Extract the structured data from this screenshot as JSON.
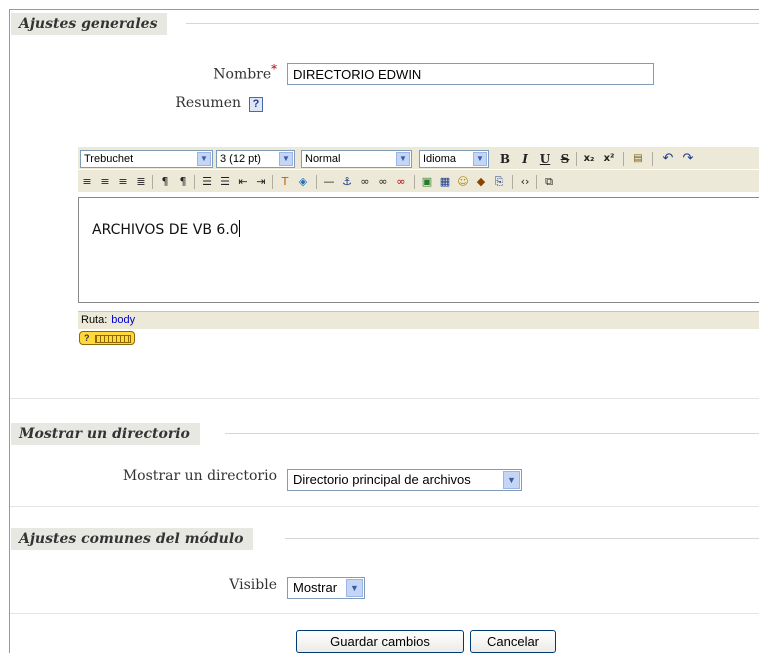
{
  "general": {
    "legend": "Ajustes generales",
    "name_label": "Nombre",
    "required_mark": "*",
    "name_value": "DIRECTORIO EDWIN",
    "summary_label": "Resumen",
    "help_icon": "help-icon"
  },
  "editor": {
    "font_value": "Trebuchet",
    "size_value": "3 (12 pt)",
    "format_value": "Normal",
    "language_value": "Idioma",
    "bold": "B",
    "italic": "I",
    "underline": "U",
    "strike": "S",
    "subscript": "x₂",
    "superscript": "x²",
    "content": "ARCHIVOS DE VB 6.0",
    "path_label": "Ruta:",
    "path_value": "body",
    "kbd_help": "?"
  },
  "display": {
    "legend": "Mostrar un directorio",
    "label": "Mostrar un directorio",
    "value": "Directorio principal de archivos"
  },
  "common": {
    "legend": "Ajustes comunes del módulo",
    "visible_label": "Visible",
    "visible_value": "Mostrar"
  },
  "actions": {
    "save": "Guardar cambios",
    "cancel": "Cancelar"
  }
}
